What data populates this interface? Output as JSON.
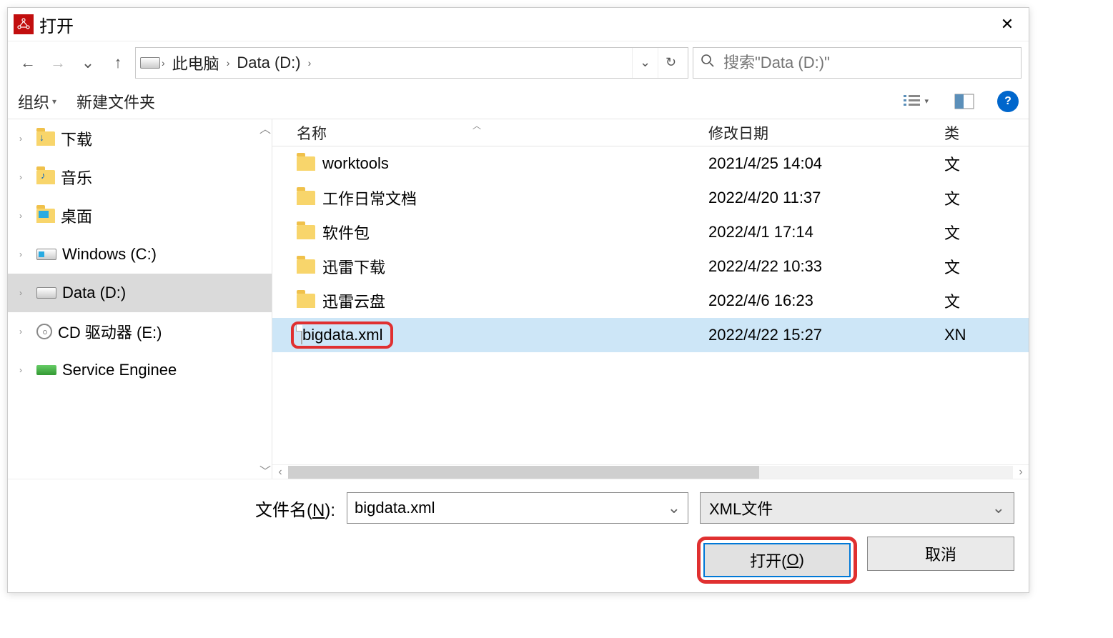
{
  "title": "打开",
  "breadcrumb": {
    "pc": "此电脑",
    "drive": "Data (D:)"
  },
  "search_placeholder": "搜索\"Data (D:)\"",
  "toolbar": {
    "organize": "组织",
    "newfolder": "新建文件夹"
  },
  "columns": {
    "name": "名称",
    "date": "修改日期",
    "type": "类"
  },
  "tree": [
    {
      "label": "下载",
      "icon": "dl"
    },
    {
      "label": "音乐",
      "icon": "music"
    },
    {
      "label": "桌面",
      "icon": "desk"
    },
    {
      "label": "Windows (C:)",
      "icon": "win"
    },
    {
      "label": "Data (D:)",
      "icon": "drive",
      "selected": true
    },
    {
      "label": "CD 驱动器 (E:)",
      "icon": "cd"
    },
    {
      "label": "Service Enginee",
      "icon": "svc"
    }
  ],
  "files": [
    {
      "name": "worktools",
      "date": "2021/4/25 14:04",
      "type": "文",
      "kind": "folder"
    },
    {
      "name": "工作日常文档",
      "date": "2022/4/20 11:37",
      "type": "文",
      "kind": "folder"
    },
    {
      "name": "软件包",
      "date": "2022/4/1 17:14",
      "type": "文",
      "kind": "folder"
    },
    {
      "name": "迅雷下载",
      "date": "2022/4/22 10:33",
      "type": "文",
      "kind": "folder"
    },
    {
      "name": "迅雷云盘",
      "date": "2022/4/6 16:23",
      "type": "文",
      "kind": "folder"
    },
    {
      "name": "bigdata.xml",
      "date": "2022/4/22 15:27",
      "type": "XN",
      "kind": "file",
      "selected": true,
      "highlight": true
    }
  ],
  "footer": {
    "filename_label_pre": "文件名(",
    "filename_label_u": "N",
    "filename_label_post": "):",
    "filename_value": "bigdata.xml",
    "filetype": "XML文件",
    "open_pre": "打开(",
    "open_u": "O",
    "open_post": ")",
    "cancel": "取消"
  }
}
